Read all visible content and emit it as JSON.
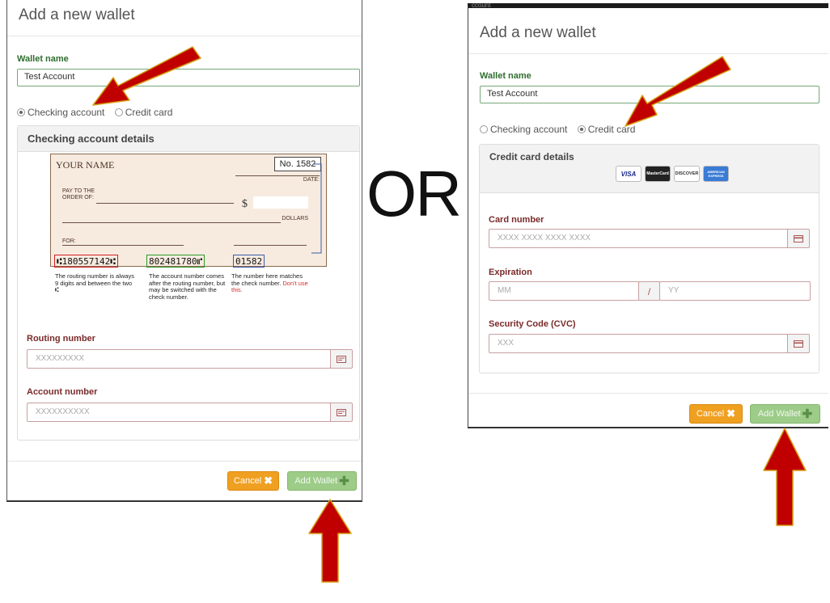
{
  "left": {
    "title": "Add a new wallet",
    "wallet_name_label": "Wallet name",
    "wallet_name_value": "Test Account",
    "radio_checking": "Checking account",
    "radio_credit": "Credit card",
    "selected": "checking",
    "panel_title": "Checking account details",
    "check": {
      "your_name": "YOUR NAME",
      "number": "No. 1582",
      "date_label": "DATE:",
      "pay_to_1": "PAY TO THE",
      "pay_to_2": "ORDER OF:",
      "dollar_sign": "$",
      "dollars_label": "DOLLARS",
      "for_label": "FOR:",
      "micr_routing": "⑆180557142⑆",
      "micr_account": "802481780⑈",
      "micr_check": "01582"
    },
    "notes": {
      "routing": "The routing number is always 9 digits and between the two ⑆",
      "account": "The account number comes after the routing number, but may be switched with the check number.",
      "check_a": "The number here matches the check number.",
      "check_b": "Don't use this."
    },
    "routing_label": "Routing number",
    "routing_placeholder": "XXXXXXXXX",
    "account_label": "Account number",
    "account_placeholder": "XXXXXXXXXX",
    "cancel": "Cancel",
    "add": "Add Wallet"
  },
  "or": "OR",
  "right": {
    "top_text": "ccount",
    "title": "Add a new wallet",
    "wallet_name_label": "Wallet name",
    "wallet_name_value": "Test Account",
    "radio_checking": "Checking account",
    "radio_credit": "Credit card",
    "selected": "credit",
    "panel_title": "Credit card details",
    "brands": [
      "VISA",
      "MasterCard",
      "DISCOVER",
      "AMERICAN EXPRESS"
    ],
    "card_label": "Card number",
    "card_placeholder": "XXXX XXXX XXXX XXXX",
    "exp_label": "Expiration",
    "exp_mm": "MM",
    "exp_sep": "/",
    "exp_yy": "YY",
    "cvc_label": "Security Code (CVC)",
    "cvc_placeholder": "XXX",
    "cancel": "Cancel",
    "add": "Add Wallet"
  },
  "colors": {
    "label_green": "#2f6d2f",
    "label_maroon": "#7a2a2a",
    "cancel_orange": "#f0a020",
    "add_green": "#9ccc88",
    "arrow_red": "#c00000",
    "arrow_outline": "#d4a017"
  }
}
